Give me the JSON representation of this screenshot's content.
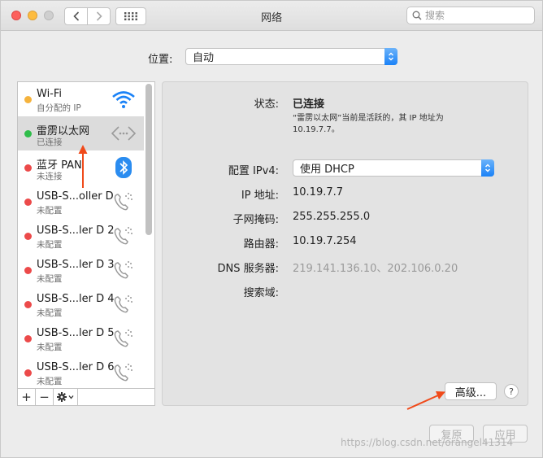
{
  "window": {
    "title": "网络"
  },
  "search": {
    "placeholder": "搜索"
  },
  "location": {
    "label": "位置:",
    "value": "自动"
  },
  "services": [
    {
      "name": "Wi-Fi",
      "status": "自分配的 IP",
      "dot": "#f5b33d",
      "icon": "wifi-icon"
    },
    {
      "name": "雷雳以太网",
      "status": "已连接",
      "dot": "#2fbd4a",
      "icon": "ethernet-icon"
    },
    {
      "name": "蓝牙 PAN",
      "status": "未连接",
      "dot": "#ec4a4a",
      "icon": "bluetooth-icon"
    },
    {
      "name": "USB-S...oller D",
      "status": "未配置",
      "dot": "#ec4a4a",
      "icon": "phone-icon"
    },
    {
      "name": "USB-S...ler D 2",
      "status": "未配置",
      "dot": "#ec4a4a",
      "icon": "phone-icon"
    },
    {
      "name": "USB-S...ler D 3",
      "status": "未配置",
      "dot": "#ec4a4a",
      "icon": "phone-icon"
    },
    {
      "name": "USB-S...ler D 4",
      "status": "未配置",
      "dot": "#ec4a4a",
      "icon": "phone-icon"
    },
    {
      "name": "USB-S...ler D 5",
      "status": "未配置",
      "dot": "#ec4a4a",
      "icon": "phone-icon"
    },
    {
      "name": "USB-S...ler D 6",
      "status": "未配置",
      "dot": "#ec4a4a",
      "icon": "phone-icon"
    }
  ],
  "sidebar_controls": {
    "add": "+",
    "remove": "−"
  },
  "detail": {
    "status_label": "状态:",
    "status_value": "已连接",
    "status_note": "“雷雳以太网”当前是活跃的，其 IP 地址为 10.19.7.7。",
    "configure_label": "配置 IPv4:",
    "configure_value": "使用 DHCP",
    "ip_label": "IP 地址:",
    "ip_value": "10.19.7.7",
    "subnet_label": "子网掩码:",
    "subnet_value": "255.255.255.0",
    "router_label": "路由器:",
    "router_value": "10.19.7.254",
    "dns_label": "DNS 服务器:",
    "dns_value": "219.141.136.10、202.106.0.20",
    "search_domain_label": "搜索域:",
    "advanced_button": "高级...",
    "help_button": "?"
  },
  "footer": {
    "revert_button": "复原",
    "apply_button": "应用"
  },
  "watermark": "https://blog.csdn.net/orangel41314",
  "colors": {
    "accent": "#1a82f7",
    "annotation": "#f04a1a"
  }
}
